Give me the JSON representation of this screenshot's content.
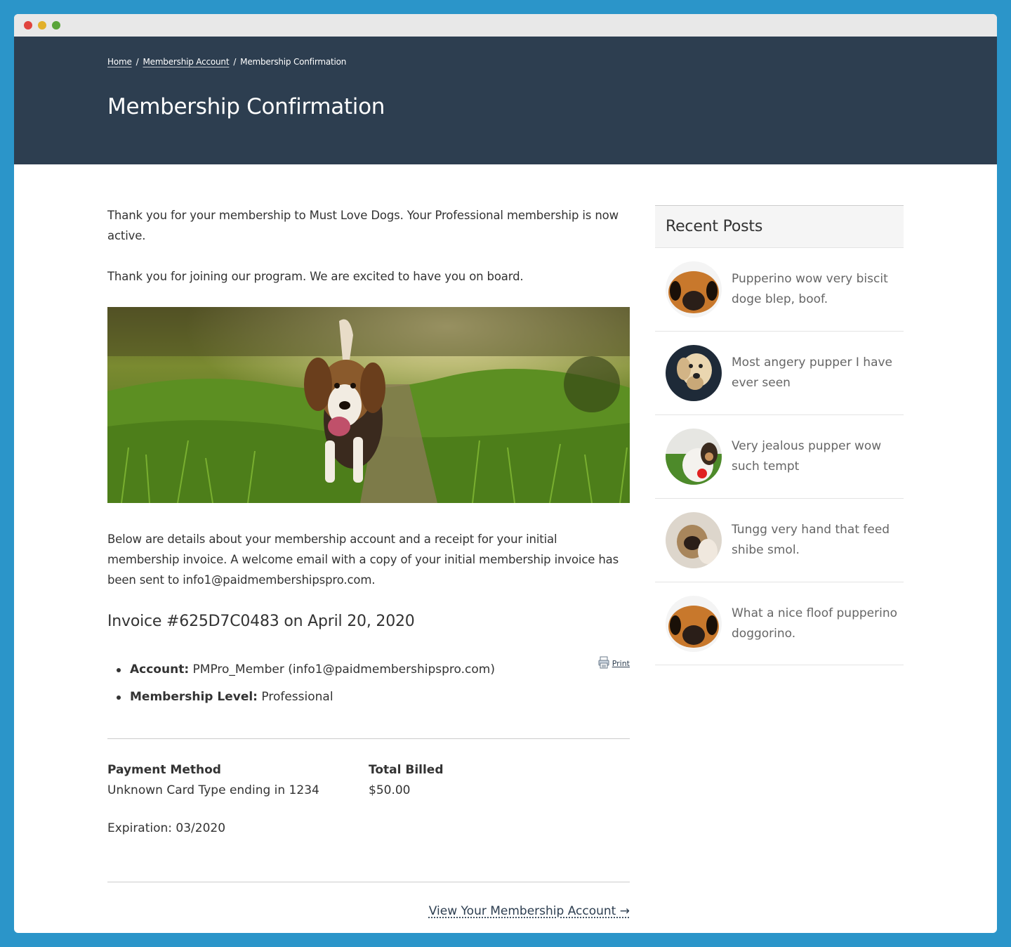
{
  "window": {
    "controls": [
      "close",
      "minimize",
      "zoom"
    ]
  },
  "breadcrumb": {
    "items": [
      {
        "label": "Home"
      },
      {
        "label": "Membership Account"
      },
      {
        "label": "Membership Confirmation"
      }
    ],
    "separator": "/"
  },
  "page": {
    "title": "Membership Confirmation"
  },
  "main": {
    "intro": "Thank you for your membership to Must Love Dogs. Your Professional membership is now active.",
    "welcome": "Thank you for joining our program. We are excited to have you on board.",
    "details_text": "Below are details about your membership account and a receipt for your initial membership invoice. A welcome email with a copy of your initial membership invoice has been sent to info1@paidmembershipspro.com.",
    "invoice_title": "Invoice #625D7C0483 on April 20, 2020",
    "print_label": "Print",
    "account_label": "Account:",
    "account_value": "PMPro_Member (info1@paidmembershipspro.com)",
    "level_label": "Membership Level:",
    "level_value": "Professional",
    "payment_method_label": "Payment Method",
    "payment_method_value": "Unknown Card Type ending in 1234",
    "total_billed_label": "Total Billed",
    "total_billed_value": "$50.00",
    "expiration": "Expiration: 03/2020",
    "account_link": "View Your Membership Account →"
  },
  "sidebar": {
    "heading": "Recent Posts",
    "posts": [
      {
        "title": "Pupperino wow very biscit doge blep, boof."
      },
      {
        "title": "Most angery pupper I have ever seen"
      },
      {
        "title": "Very jealous pupper wow such tempt"
      },
      {
        "title": "Tungg very hand that feed shibe smol."
      },
      {
        "title": "What a nice floof pupperino doggorino."
      }
    ]
  },
  "colors": {
    "frame": "#2b95c9",
    "header": "#2d3e50",
    "text": "#333333",
    "muted": "#666666"
  }
}
